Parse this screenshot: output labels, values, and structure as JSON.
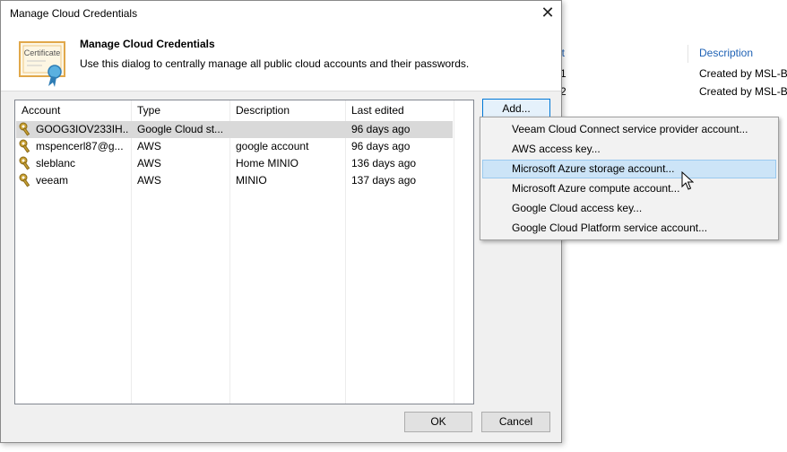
{
  "background": {
    "col_header_partial": "et",
    "col_header_description": "Description",
    "rows": [
      {
        "name_partial": "-1",
        "description_partial": "Created by MSL-BI"
      },
      {
        "name_partial": "-2",
        "description_partial": "Created by MSL-BF"
      }
    ]
  },
  "dialog": {
    "title": "Manage Cloud Credentials",
    "close_glyph": "✕",
    "header": {
      "title": "Manage Cloud Credentials",
      "description": "Use this dialog to centrally manage all public cloud accounts and their passwords.",
      "icon": "certificate-icon",
      "icon_label": "Certificate"
    },
    "table": {
      "columns": [
        "Account",
        "Type",
        "Description",
        "Last edited"
      ],
      "rows": [
        {
          "account": "GOOG3IOV233IH...",
          "type": "Google Cloud st...",
          "description": "",
          "last_edited": "96 days ago",
          "selected": true
        },
        {
          "account": "mspencerl87@g...",
          "type": "AWS",
          "description": "google account",
          "last_edited": "96 days ago",
          "selected": false
        },
        {
          "account": "sleblanc",
          "type": "AWS",
          "description": "Home MINIO",
          "last_edited": "136 days ago",
          "selected": false
        },
        {
          "account": "veeam",
          "type": "AWS",
          "description": "MINIO",
          "last_edited": "137 days ago",
          "selected": false
        }
      ]
    },
    "buttons": {
      "add": "Add...",
      "ok": "OK",
      "cancel": "Cancel"
    },
    "add_menu": {
      "items": [
        "Veeam Cloud Connect service provider account...",
        "AWS access key...",
        "Microsoft Azure storage account...",
        "Microsoft Azure compute account...",
        "Google Cloud access key...",
        "Google Cloud Platform service account..."
      ],
      "hovered_index": 2
    }
  },
  "colors": {
    "link_blue": "#1f62b5",
    "selection_gray": "#d9d9d9",
    "menu_hover": "#cce4f7",
    "key_gold": "#c8a032"
  }
}
